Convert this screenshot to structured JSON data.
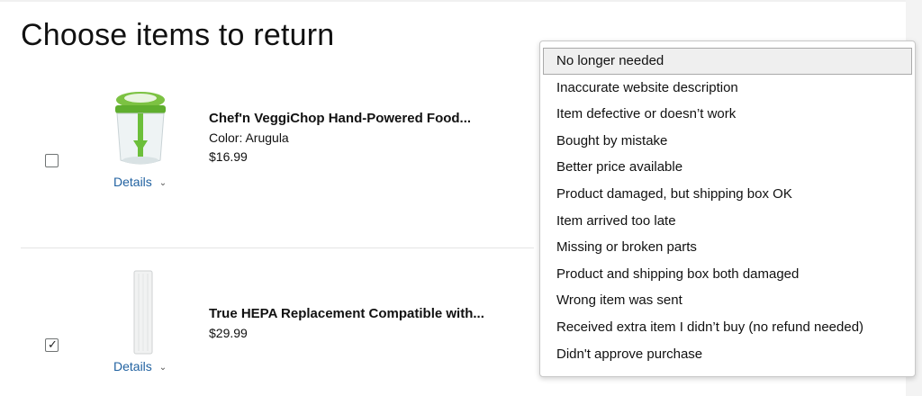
{
  "page": {
    "title": "Choose items to return"
  },
  "items": [
    {
      "title": "Chef'n VeggiChop Hand-Powered Food...",
      "color": "Color: Arugula",
      "price": "$16.99",
      "details_label": "Details",
      "checked": false
    },
    {
      "title": "True HEPA Replacement Compatible with...",
      "price": "$29.99",
      "details_label": "Details",
      "checked": true
    }
  ],
  "return_reasons": {
    "selected": "No longer needed",
    "options": [
      "No longer needed",
      "Inaccurate website description",
      "Item defective or doesn’t work",
      "Bought by mistake",
      "Better price available",
      "Product damaged, but shipping box OK",
      "Item arrived too late",
      "Missing or broken parts",
      "Product and shipping box both damaged",
      "Wrong item was sent",
      "Received extra item I didn’t buy (no refund needed)",
      "Didn't approve purchase"
    ]
  },
  "icons": {
    "checkmark": "check-icon",
    "chevron": "chevron-down-icon"
  },
  "colors": {
    "link": "#2162a1",
    "dropdown_border": "#c8c8c8",
    "selected_bg": "#efefef"
  }
}
